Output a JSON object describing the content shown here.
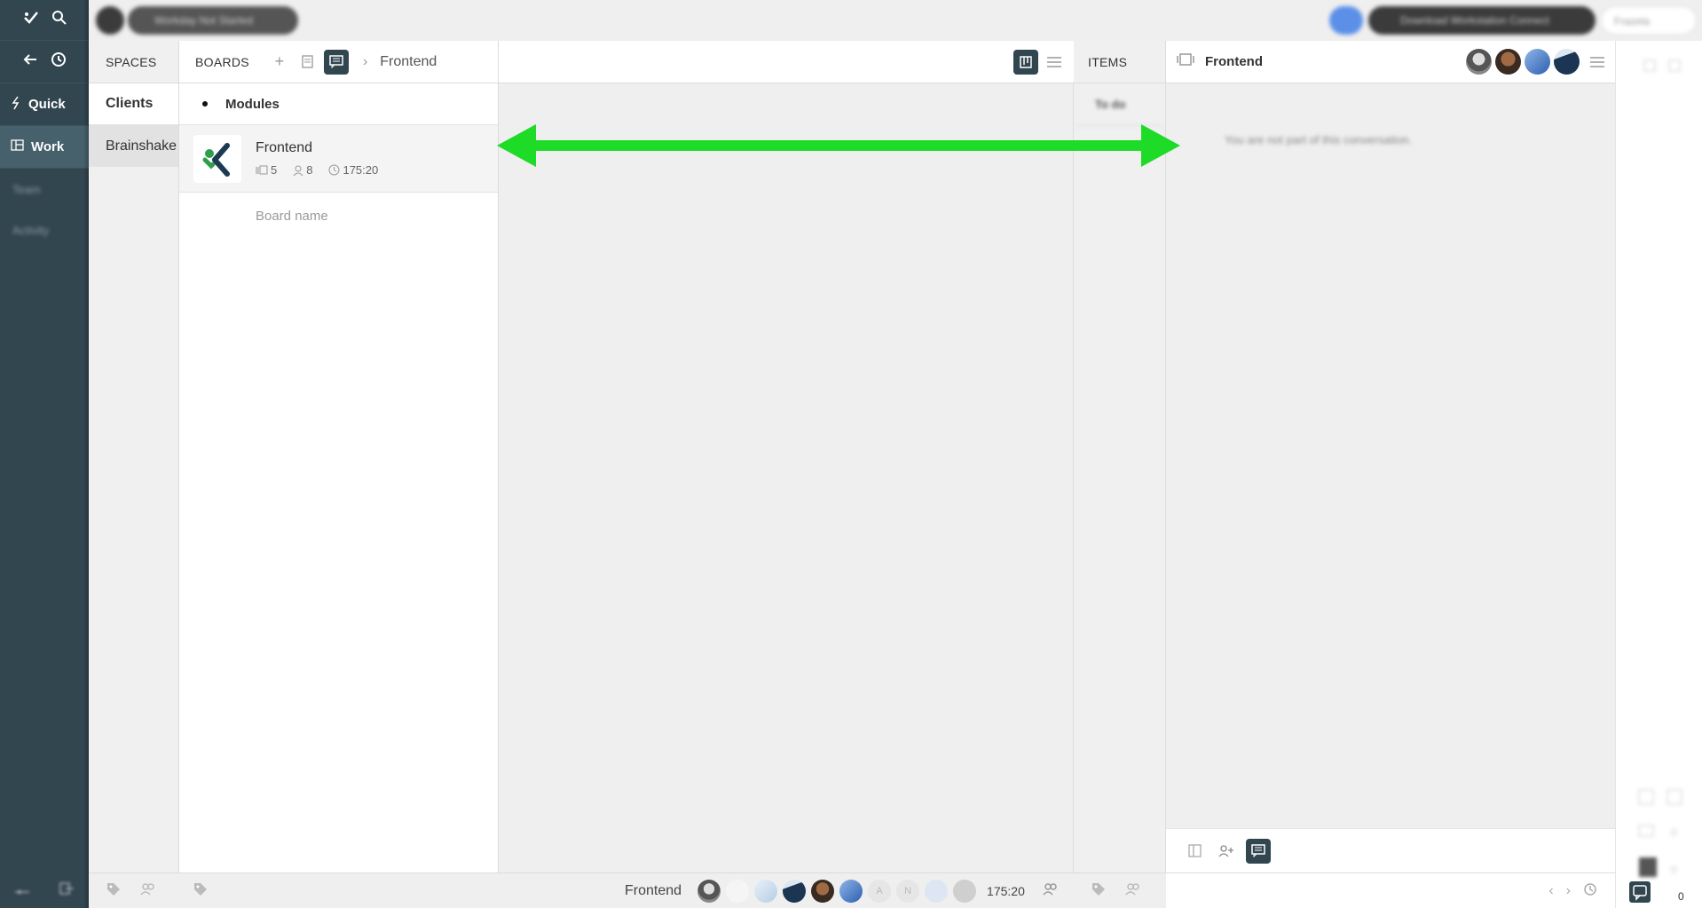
{
  "rail": {
    "nav": [
      {
        "label": "Quick",
        "icon": "lightning-icon"
      },
      {
        "label": "Work",
        "icon": "board-icon"
      }
    ],
    "blurred": [
      "Team",
      "Activity"
    ]
  },
  "topbar": {
    "blurred_pill_left": "Workday Not Started",
    "blurred_pill_right": "Download Workstation Connect",
    "blurred_right_label": "Frazela"
  },
  "spaces": {
    "header": "SPACES",
    "items": [
      {
        "label": "Clients"
      },
      {
        "label": "Brainshake"
      }
    ]
  },
  "boards": {
    "header": "BOARDS",
    "breadcrumb": "Frontend",
    "group": "Modules",
    "board": {
      "title": "Frontend",
      "items_count": "5",
      "members_count": "8",
      "time": "175:20"
    },
    "new_board_placeholder": "Board name"
  },
  "items": {
    "header": "ITEMS",
    "blurred_first": "To do"
  },
  "chat": {
    "title": "Frontend",
    "notice": "You are not part of this conversation."
  },
  "statusbar": {
    "board_name": "Frontend",
    "time": "175:20",
    "initials": [
      "A",
      "N"
    ]
  },
  "colors": {
    "rail": "#324650",
    "arrow": "#1edb28",
    "accent_dark": "#324650"
  }
}
